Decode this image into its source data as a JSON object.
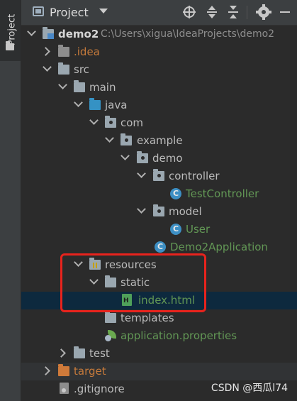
{
  "side_panel": {
    "tab_label": "Project",
    "tab_icon": "folder-icon"
  },
  "header": {
    "title": "Project",
    "buttons": [
      "locate-icon",
      "expand-all-icon",
      "collapse-all-icon",
      "gear-icon",
      "minimize-icon"
    ]
  },
  "tree": [
    {
      "name": "demo2",
      "path": "C:\\Users\\xigua\\IdeaProjects\\demo2",
      "icon": "module-folder-icon",
      "expanded": true
    },
    {
      "name": ".idea",
      "icon": "folder-icon",
      "expanded": false
    },
    {
      "name": "src",
      "icon": "folder-icon",
      "expanded": true
    },
    {
      "name": "main",
      "icon": "folder-icon",
      "expanded": true
    },
    {
      "name": "java",
      "icon": "source-root-icon",
      "expanded": true
    },
    {
      "name": "com",
      "icon": "package-icon",
      "expanded": true
    },
    {
      "name": "example",
      "icon": "package-icon",
      "expanded": true
    },
    {
      "name": "demo",
      "icon": "package-icon",
      "expanded": true
    },
    {
      "name": "controller",
      "icon": "package-icon",
      "expanded": true
    },
    {
      "name": "TestController",
      "icon": "java-class-icon"
    },
    {
      "name": "model",
      "icon": "package-icon",
      "expanded": true
    },
    {
      "name": "User",
      "icon": "java-class-icon"
    },
    {
      "name": "Demo2Application",
      "icon": "spring-boot-class-icon"
    },
    {
      "name": "resources",
      "icon": "resources-root-icon",
      "expanded": true
    },
    {
      "name": "static",
      "icon": "folder-icon",
      "expanded": true
    },
    {
      "name": "index.html",
      "icon": "html-file-icon",
      "selected": true
    },
    {
      "name": "templates",
      "icon": "folder-icon"
    },
    {
      "name": "application.properties",
      "icon": "spring-properties-icon"
    },
    {
      "name": "test",
      "icon": "folder-icon",
      "expanded": false
    },
    {
      "name": "target",
      "icon": "excluded-folder-icon",
      "expanded": false
    },
    {
      "name": ".gitignore",
      "icon": "gitignore-file-icon"
    }
  ],
  "watermark": "CSDN @西瓜l74",
  "colors": {
    "background": "#2b2b2b",
    "selection": "#0d293e",
    "green_text": "#629755",
    "orange_text": "#c57a3b",
    "highlight_border": "#e8231d"
  }
}
